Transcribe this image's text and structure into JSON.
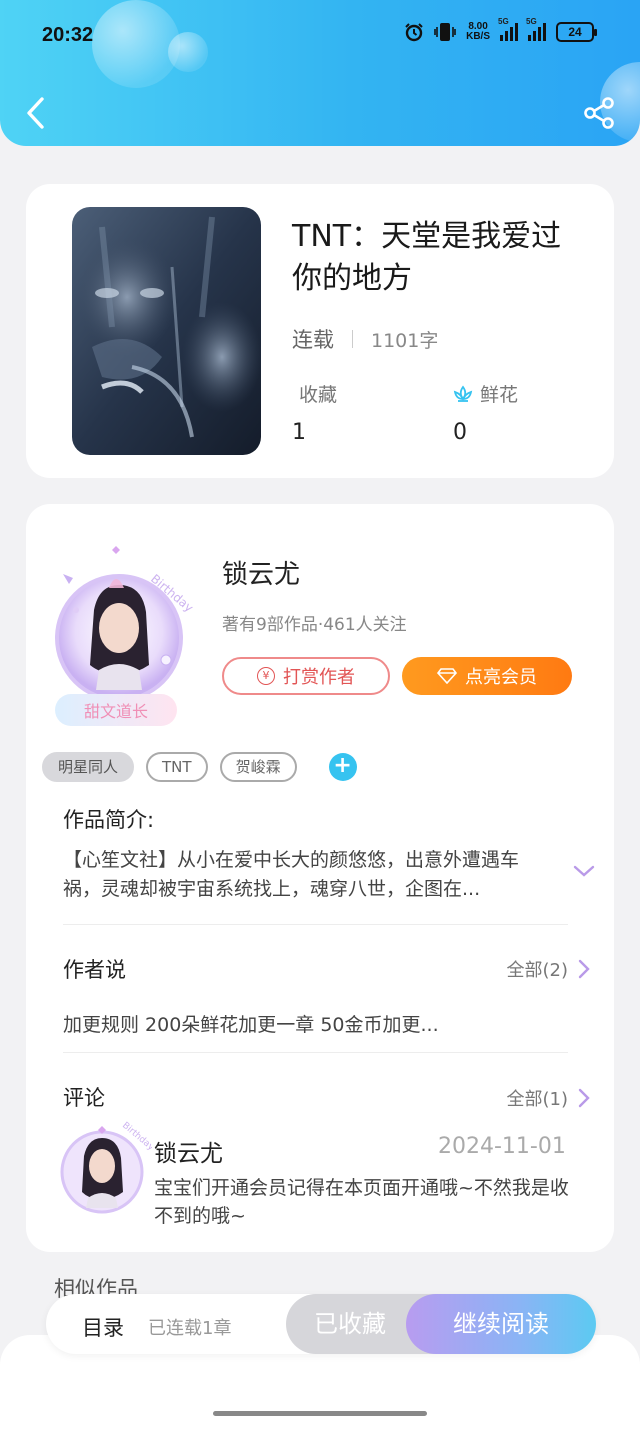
{
  "status_bar": {
    "time": "20:32",
    "net_speed_value": "8.00",
    "net_speed_unit": "KB/S",
    "battery": "24",
    "sig1_label": "5G",
    "sig2_label": "5G"
  },
  "header": {
    "back_icon": "chevron-left-icon",
    "share_icon": "share-icon",
    "colors": [
      "#4fd3f5",
      "#2aa4f4"
    ]
  },
  "book": {
    "title": "TNT：天堂是我爱过你的地方",
    "status": "连载",
    "word_count": "1101字",
    "favorites_label": "收藏",
    "favorites_value": "1",
    "flowers_label": "鲜花",
    "flowers_value": "0"
  },
  "author": {
    "name": "锁云尤",
    "stats": "著有9部作品·461人关注",
    "badge": "甜文道长",
    "reward_label": "打赏作者",
    "reward_icon_text": "¥",
    "vip_label": "点亮会员"
  },
  "tags": [
    "明星同人",
    "TNT",
    "贺峻霖"
  ],
  "intro": {
    "title": "作品简介:",
    "text": "【心笙文社】从小在爱中长大的颜悠悠，出意外遭遇车祸，灵魂却被宇宙系统找上，魂穿八世，企图在..."
  },
  "author_say": {
    "title": "作者说",
    "more": "全部(2)",
    "text": "加更规则 200朵鲜花加更一章 50金币加更..."
  },
  "comments": {
    "title": "评论",
    "more": "全部(1)",
    "items": [
      {
        "name": "锁云尤",
        "date": "2024-11-01",
        "text": "宝宝们开通会员记得在本页面开通哦~不然我是收不到的哦~"
      }
    ]
  },
  "similar_title": "相似作品",
  "bottom_bar": {
    "toc_label": "目录",
    "toc_sub": "已连载1章",
    "fav_label": "已收藏",
    "read_label": "继续阅读"
  },
  "accent_colors": {
    "orange": "#ff8a18",
    "blue": "#36c3f0",
    "red": "#e25555"
  }
}
